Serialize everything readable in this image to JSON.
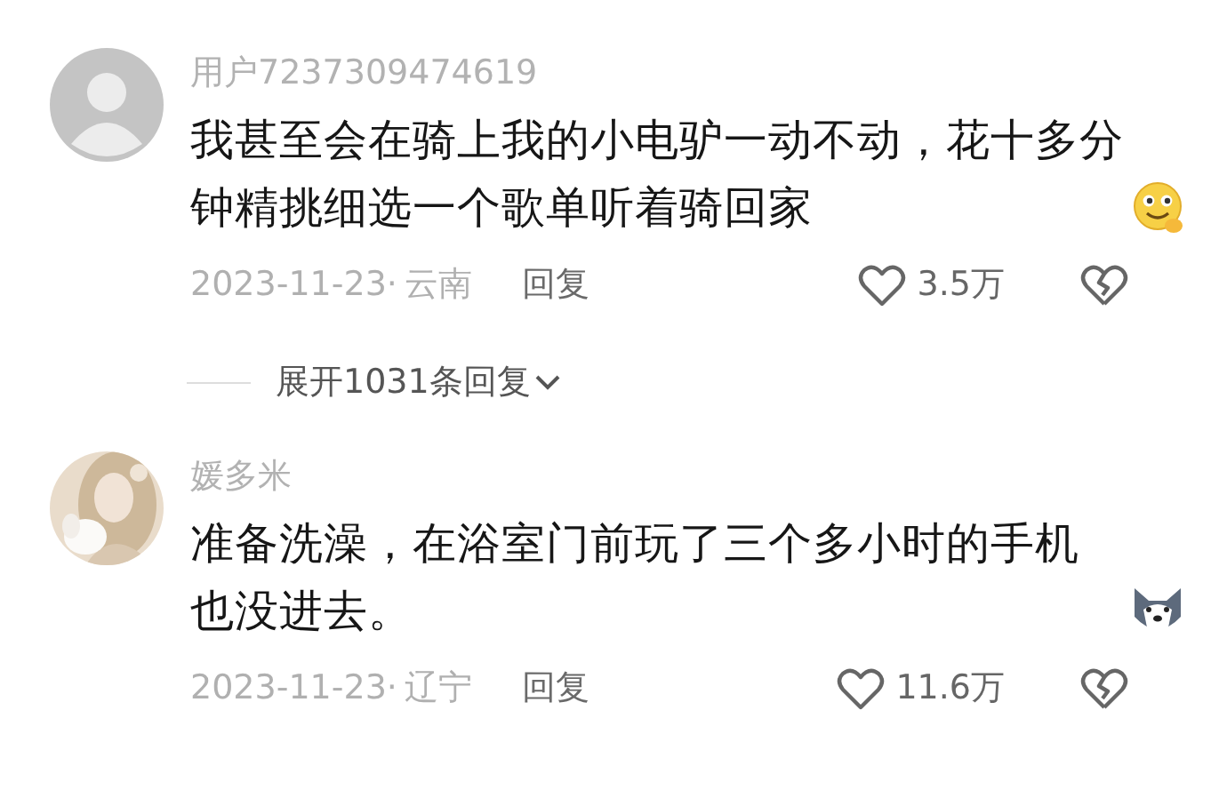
{
  "comments": [
    {
      "avatar": {
        "kind": "default"
      },
      "username": "用户7237309474619",
      "text": "我甚至会在骑上我的小电驴一动不动，花十多分钟精挑细选一个歌单听着骑回家",
      "emoji": {
        "kind": "smile"
      },
      "date": "2023-11-23·",
      "location": "云南",
      "reply": "回复",
      "likes": "3.5万",
      "replies": {
        "label": "展开1031条回复"
      }
    },
    {
      "username": "媛多米",
      "text": "准备洗澡，在浴室门前玩了三个多小时的手机也没进去。",
      "emoji": {
        "kind": "husky"
      },
      "date": "2023-11-23·",
      "location": "辽宁",
      "reply": "回复",
      "likes": "11.6万"
    }
  ]
}
